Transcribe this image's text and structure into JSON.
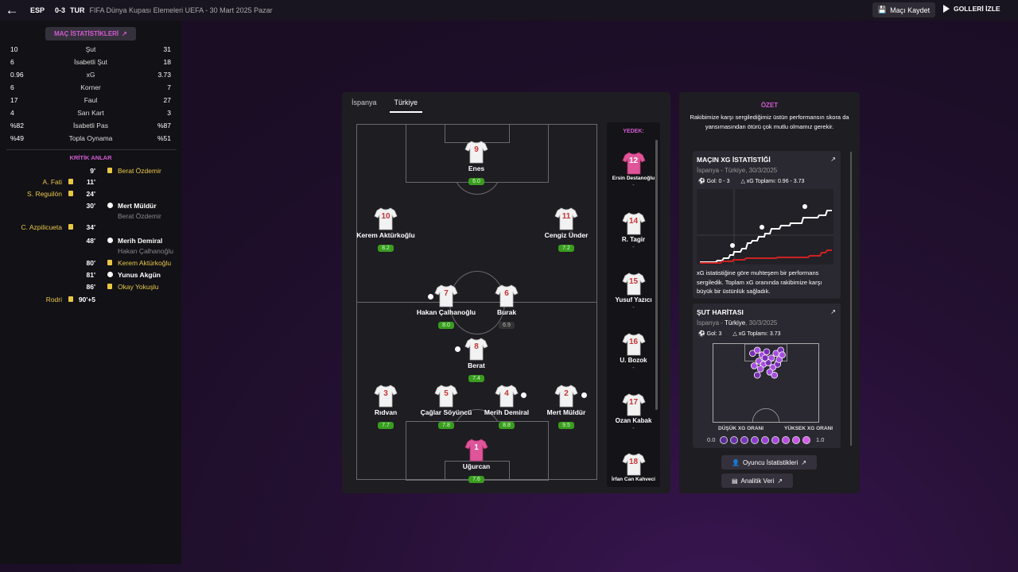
{
  "header": {
    "home_abbr": "ESP",
    "score": "0-3",
    "away_abbr": "TUR",
    "competition": "FIFA Dünya Kupası Elemeleri UEFA",
    "date": "30 Mart 2025 Pazar",
    "save_label": "Maçı Kaydet",
    "watch_label": "GOLLERİ İZLE"
  },
  "stats": {
    "button_label": "MAÇ İSTATİSTİKLERİ",
    "rows": [
      {
        "label": "Şut",
        "home": "10",
        "away": "31"
      },
      {
        "label": "İsabetli Şut",
        "home": "6",
        "away": "18"
      },
      {
        "label": "xG",
        "home": "0.96",
        "away": "3.73"
      },
      {
        "label": "Korner",
        "home": "6",
        "away": "7"
      },
      {
        "label": "Faul",
        "home": "17",
        "away": "27"
      },
      {
        "label": "Sarı Kart",
        "home": "4",
        "away": "3"
      },
      {
        "label": "İsabetli Pas",
        "home": "%82",
        "away": "%87"
      },
      {
        "label": "Topla Oynama",
        "home": "%49",
        "away": "%51"
      }
    ]
  },
  "moments": {
    "title": "KRİTİK ANLAR",
    "items": [
      {
        "minute": "9'",
        "home": "",
        "away": "Berat Özdemir",
        "home_type": "",
        "away_type": "yellow",
        "sub": ""
      },
      {
        "minute": "11'",
        "home": "A. Fati",
        "away": "",
        "home_type": "yellow",
        "away_type": "",
        "sub": ""
      },
      {
        "minute": "24'",
        "home": "S. Reguilón",
        "away": "",
        "home_type": "yellow",
        "away_type": "",
        "sub": ""
      },
      {
        "minute": "30'",
        "home": "",
        "away": "Mert Müldür",
        "home_type": "",
        "away_type": "goal",
        "sub": "Berat Özdemir"
      },
      {
        "minute": "34'",
        "home": "C. Azpilicueta",
        "away": "",
        "home_type": "yellow",
        "away_type": "",
        "sub": ""
      },
      {
        "minute": "48'",
        "home": "",
        "away": "Merih Demiral",
        "home_type": "",
        "away_type": "goal",
        "sub": "Hakan Çalhanoğlu"
      },
      {
        "minute": "80'",
        "home": "",
        "away": "Kerem Aktürkoğlu",
        "home_type": "",
        "away_type": "yellow",
        "sub": ""
      },
      {
        "minute": "81'",
        "home": "",
        "away": "Yunus Akgün",
        "home_type": "",
        "away_type": "goal",
        "sub": ""
      },
      {
        "minute": "86'",
        "home": "",
        "away": "Okay Yokuşlu",
        "home_type": "",
        "away_type": "yellow",
        "sub": ""
      },
      {
        "minute": "90'+5",
        "home": "Rodri",
        "away": "",
        "home_type": "yellow",
        "away_type": "",
        "sub": ""
      }
    ]
  },
  "lineup": {
    "tabs": [
      "İspanya",
      "Türkiye"
    ],
    "active_tab": "Türkiye",
    "players": [
      {
        "num": "9",
        "name": "Enes",
        "rating": "6.0",
        "kit": "white"
      },
      {
        "num": "10",
        "name": "Kerem Aktürkoğlu",
        "rating": "8.2",
        "kit": "white"
      },
      {
        "num": "11",
        "name": "Cengiz Ünder",
        "rating": "7.2",
        "kit": "white"
      },
      {
        "num": "7",
        "name": "Hakan Çalhanoğlu",
        "rating": "8.0",
        "kit": "white"
      },
      {
        "num": "6",
        "name": "Burak",
        "rating": "6.9",
        "kit": "white"
      },
      {
        "num": "8",
        "name": "Berat",
        "rating": "7.4",
        "kit": "white"
      },
      {
        "num": "3",
        "name": "Rıdvan",
        "rating": "7.7",
        "kit": "white"
      },
      {
        "num": "5",
        "name": "Çağlar Söyüncü",
        "rating": "7.8",
        "kit": "white"
      },
      {
        "num": "4",
        "name": "Merih Demiral",
        "rating": "8.8",
        "kit": "white"
      },
      {
        "num": "2",
        "name": "Mert Müldür",
        "rating": "9.5",
        "kit": "white"
      },
      {
        "num": "1",
        "name": "Uğurcan",
        "rating": "7.6",
        "kit": "pink"
      }
    ],
    "subs_title": "YEDEK:",
    "subs": [
      {
        "num": "12",
        "name": "Ersin Destanoğlu",
        "rating": "-",
        "kit": "pink"
      },
      {
        "num": "14",
        "name": "R. Tagir",
        "rating": "-",
        "kit": "white"
      },
      {
        "num": "15",
        "name": "Yusuf Yazıcı",
        "rating": "-",
        "kit": "white"
      },
      {
        "num": "16",
        "name": "U. Bozok",
        "rating": "-",
        "kit": "white"
      },
      {
        "num": "17",
        "name": "Ozan Kabak",
        "rating": "-",
        "kit": "white"
      },
      {
        "num": "18",
        "name": "İrfan Can Kahveci",
        "rating": "",
        "kit": "white"
      }
    ]
  },
  "summary": {
    "title": "ÖZET",
    "text": "Rakibimize karşı sergilediğimiz üstün performansın skora da yansımasından ötürü çok mutlu olmamız gerekir.",
    "xg_card": {
      "title": "MAÇIN XG İSTATİSTİĞİ",
      "meta": "İspanya - Türkiye, 30/3/2025",
      "goals": "Gol: 0 - 3",
      "xg_total": "xG Toplamı: 0.96 - 3.73",
      "text": "xG istatistiğine göre muhteşem bir performans sergiledik. Toplam xG oranında rakibimize karşı büyük bir üstünlük sağladık."
    },
    "shot_card": {
      "title": "ŞUT HARİTASI",
      "meta_pre": "İspanya - ",
      "meta_team": "Türkiye",
      "meta_post": ", 30/3/2025",
      "goals": "Gol: 3",
      "xg_total": "xG Toplamı: 3.73",
      "low_label": "DÜŞÜK XG ORANI",
      "high_label": "YÜKSEK XG ORANI",
      "scale_min": "0.0",
      "scale_max": "1.0"
    },
    "player_stats_label": "Oyuncu İstatistikleri",
    "analytics_label": "Analitik Veri"
  },
  "colors": {
    "accent": "#d25ad2",
    "home_line": "#cc2222",
    "away_line": "#ffffff",
    "rating_green": "#3a9c1f",
    "yellow_card": "#e8c840"
  }
}
